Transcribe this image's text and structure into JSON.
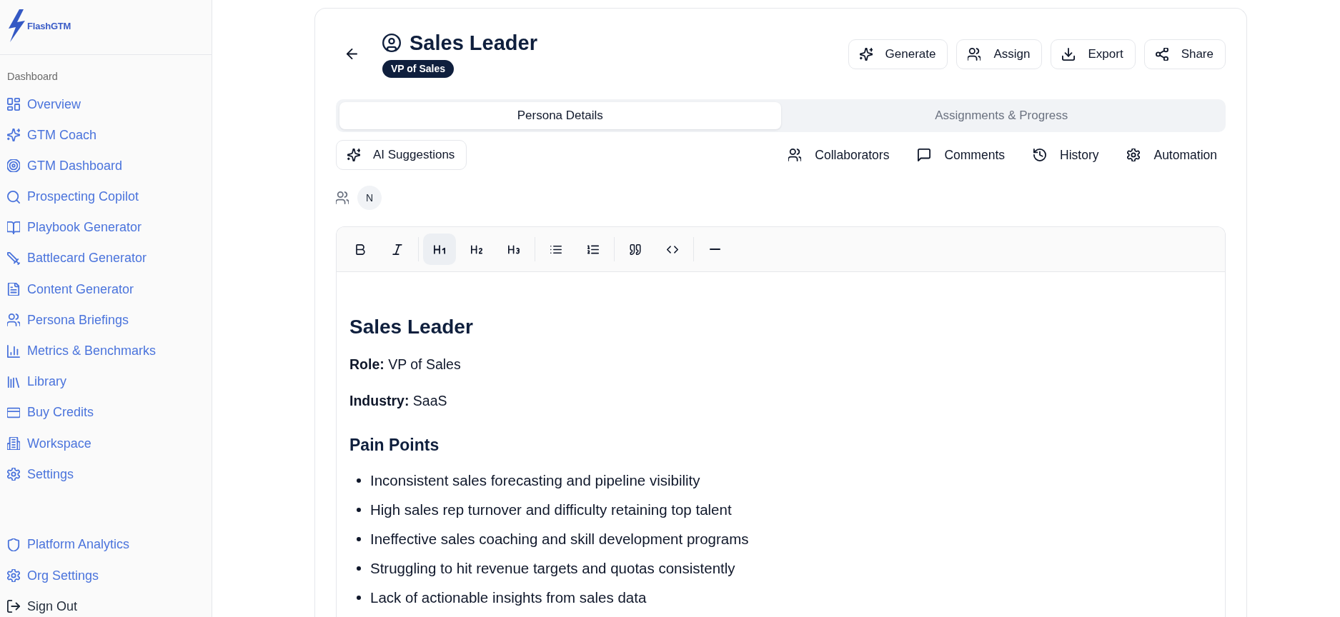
{
  "sidebar": {
    "logo": "FlashGTM",
    "section_label": "Dashboard",
    "items": [
      {
        "label": "Overview"
      },
      {
        "label": "GTM Coach"
      },
      {
        "label": "GTM Dashboard"
      },
      {
        "label": "Prospecting Copilot"
      },
      {
        "label": "Playbook Generator"
      },
      {
        "label": "Battlecard Generator"
      },
      {
        "label": "Content Generator"
      },
      {
        "label": "Persona Briefings"
      },
      {
        "label": "Metrics & Benchmarks"
      },
      {
        "label": "Library"
      },
      {
        "label": "Buy Credits"
      },
      {
        "label": "Workspace"
      },
      {
        "label": "Settings"
      }
    ],
    "footer_items": [
      {
        "label": "Platform Analytics",
        "kind": "link"
      },
      {
        "label": "Org Settings",
        "kind": "link"
      },
      {
        "label": "Sign Out",
        "kind": "action"
      }
    ]
  },
  "header": {
    "title": "Sales Leader",
    "badge": "VP of Sales",
    "buttons": [
      "Generate",
      "Assign",
      "Export",
      "Share"
    ]
  },
  "tabs": [
    {
      "label": "Persona Details",
      "selected": true
    },
    {
      "label": "Assignments & Progress",
      "selected": false
    }
  ],
  "actions": {
    "ai_button": "AI Suggestions",
    "links": [
      "Collaborators",
      "Comments",
      "History",
      "Automation"
    ]
  },
  "collaborators": [
    {
      "initial": "N"
    }
  ],
  "editor": {
    "toolbar": [
      [
        {
          "active": false
        },
        {
          "active": false
        }
      ],
      [
        {
          "active": true
        },
        {
          "active": false
        },
        {
          "active": false
        }
      ],
      [
        {
          "active": false
        },
        {
          "active": false
        }
      ],
      [
        {
          "active": false
        },
        {
          "active": false
        }
      ],
      [
        {
          "active": false
        }
      ]
    ],
    "content": [
      {
        "kind": "heading1",
        "text": "Sales Leader"
      },
      {
        "kind": "paragraph",
        "text": "**Role:** VP of Sales"
      },
      {
        "kind": "paragraph",
        "text": "**Industry:** SaaS"
      },
      {
        "kind": "heading2",
        "text": "Pain Points"
      },
      {
        "kind": "bullets",
        "items": [
          "Inconsistent sales forecasting and pipeline visibility",
          "High sales rep turnover and difficulty retaining top talent",
          "Ineffective sales coaching and skill development programs",
          "Struggling to hit revenue targets and quotas consistently",
          "Lack of actionable insights from sales data"
        ]
      }
    ]
  }
}
